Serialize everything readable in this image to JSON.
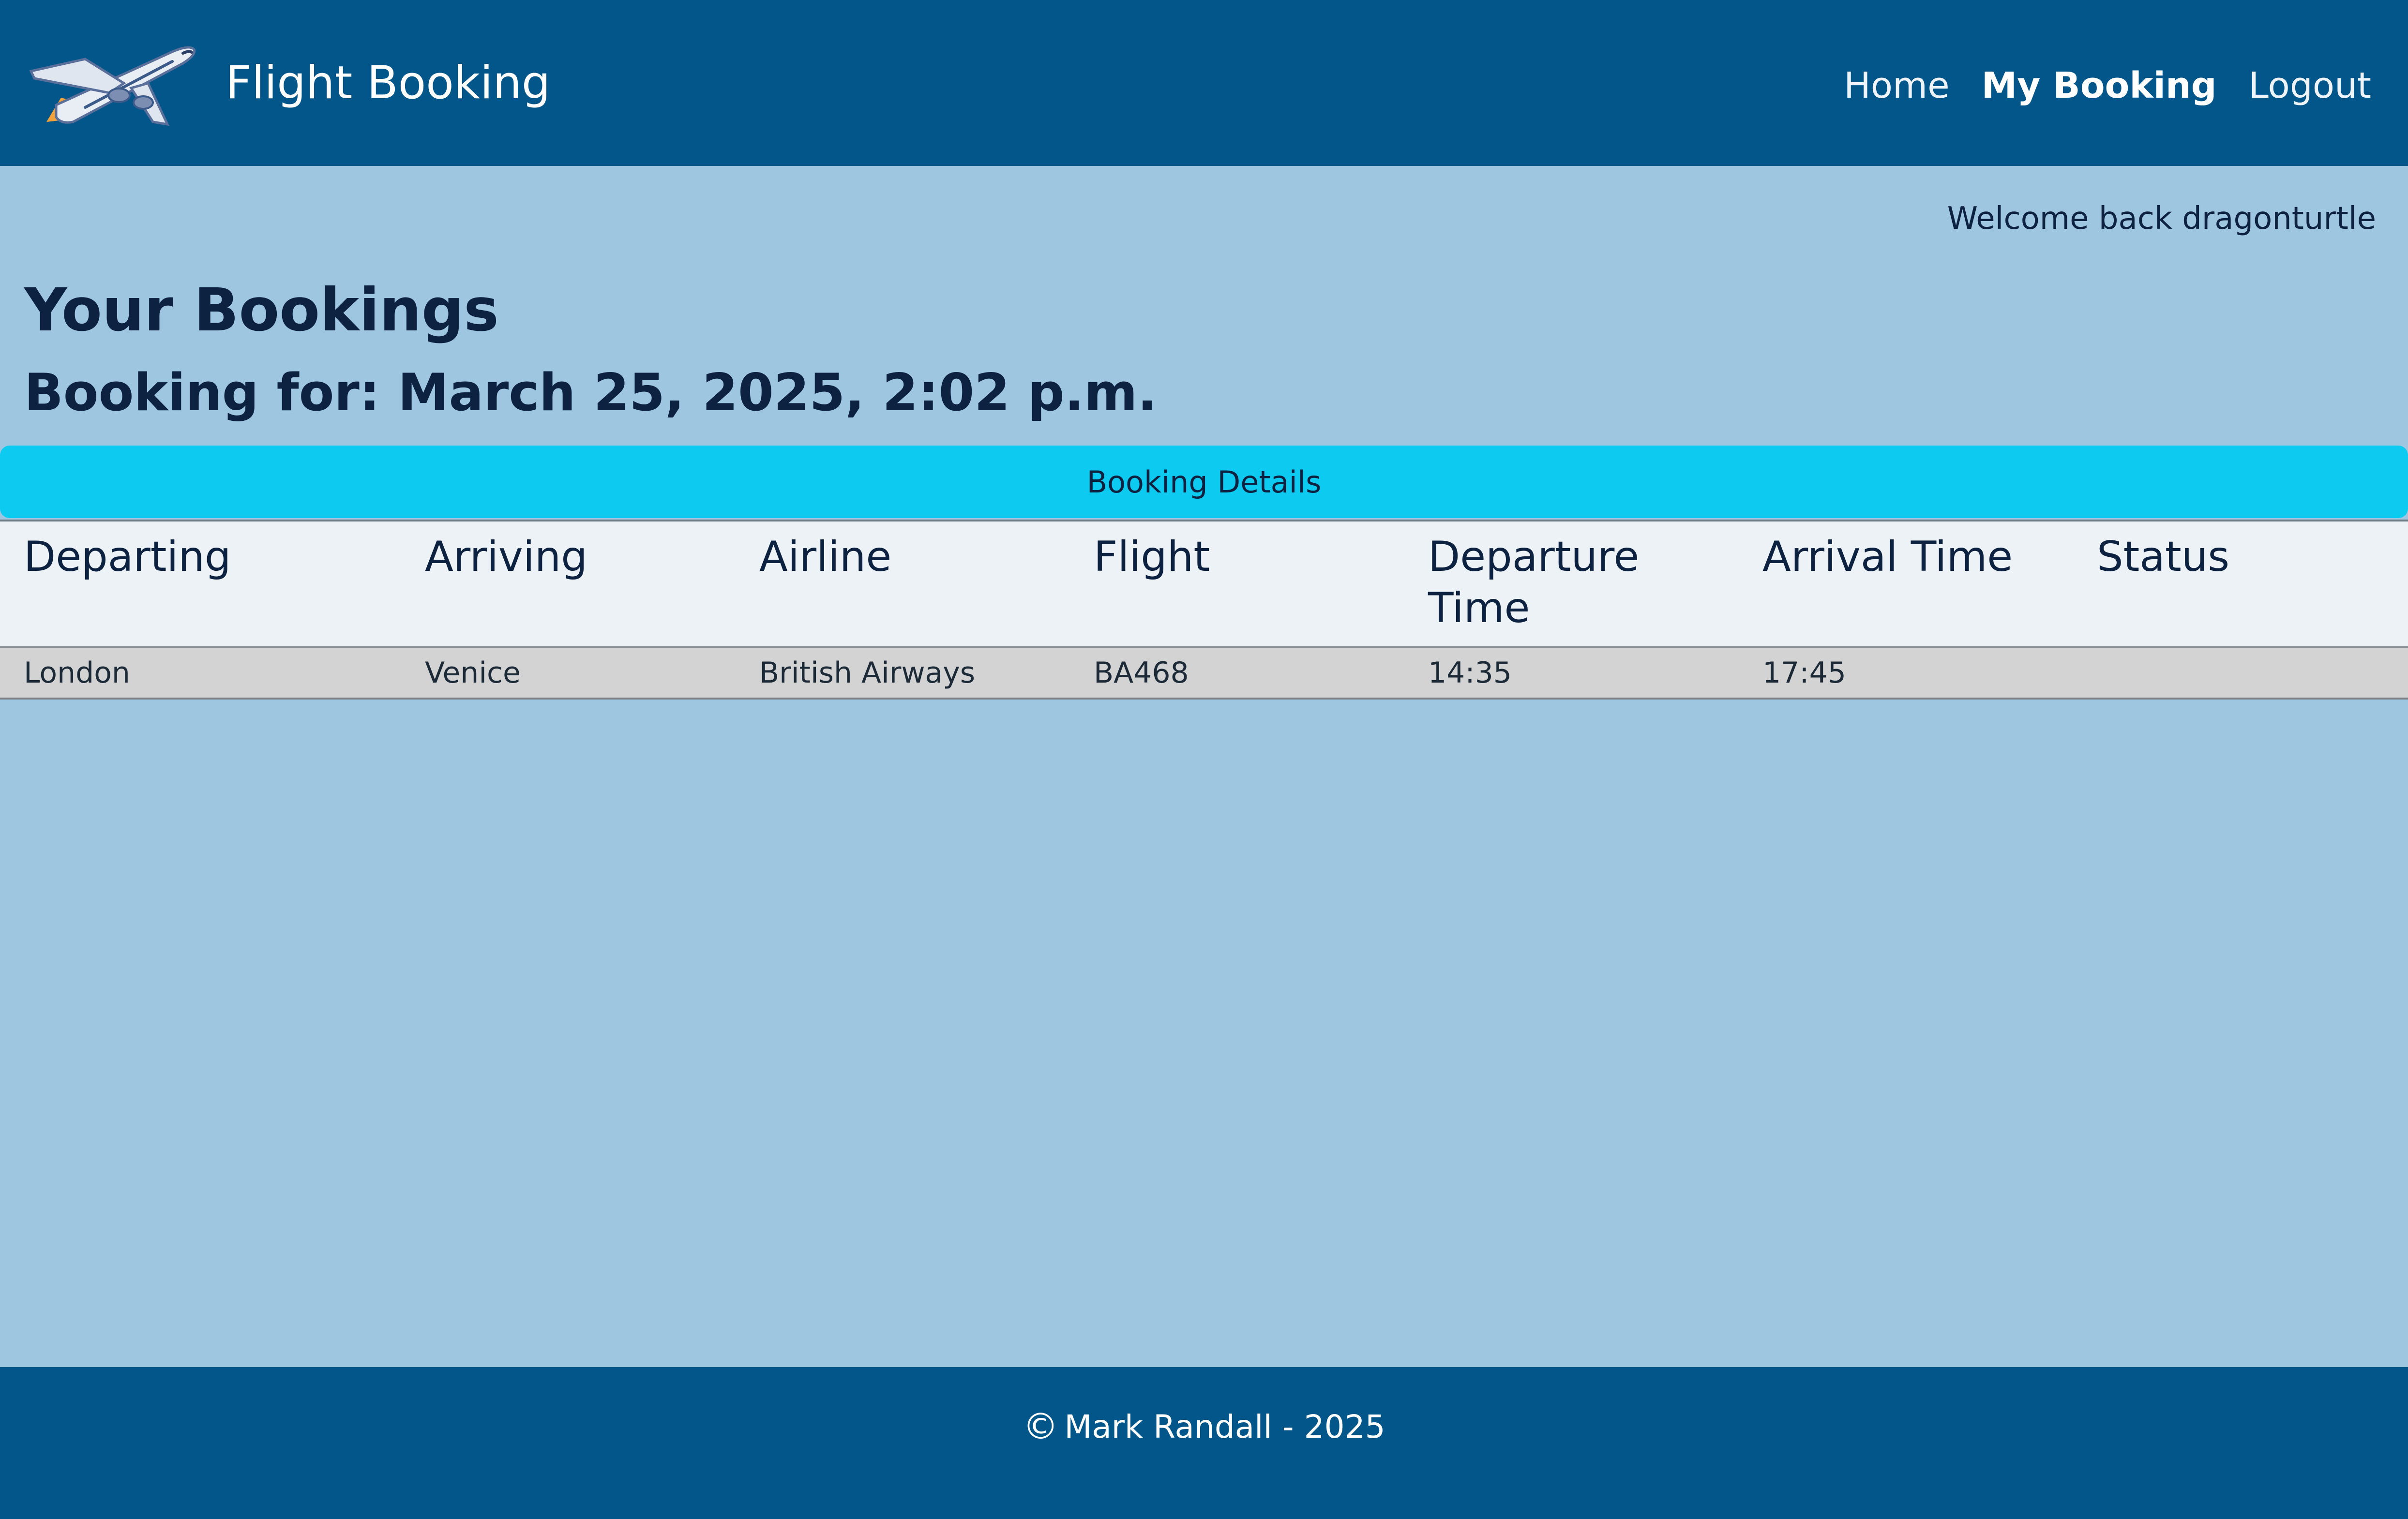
{
  "header": {
    "brand_name": "Flight Booking",
    "logo_icon": "airplane-icon",
    "nav": [
      {
        "label": "Home",
        "active": false
      },
      {
        "label": "My Booking",
        "active": true
      },
      {
        "label": "Logout",
        "active": false
      }
    ]
  },
  "welcome_text": "Welcome back dragonturtle",
  "page_title": "Your Bookings",
  "booking_for": "Booking for: March 25, 2025, 2:02 p.m.",
  "details_heading": "Booking Details",
  "table": {
    "columns": [
      "Departing",
      "Arriving",
      "Airline",
      "Flight",
      "Departure Time",
      "Arrival Time",
      "Status"
    ],
    "rows": [
      [
        "London",
        "Venice",
        "British Airways",
        "BA468",
        "14:35",
        "17:45",
        ""
      ]
    ]
  },
  "footer": {
    "copyright_symbol": "©",
    "text": "Mark Randall - 2025"
  },
  "colors": {
    "navbar": "#02568a",
    "page_background": "#9fc6e0",
    "details_bar": "#0dcaf0",
    "table_header": "#edf2f6",
    "table_row": "#d3d3d3",
    "text_dark": "#0d2240"
  }
}
